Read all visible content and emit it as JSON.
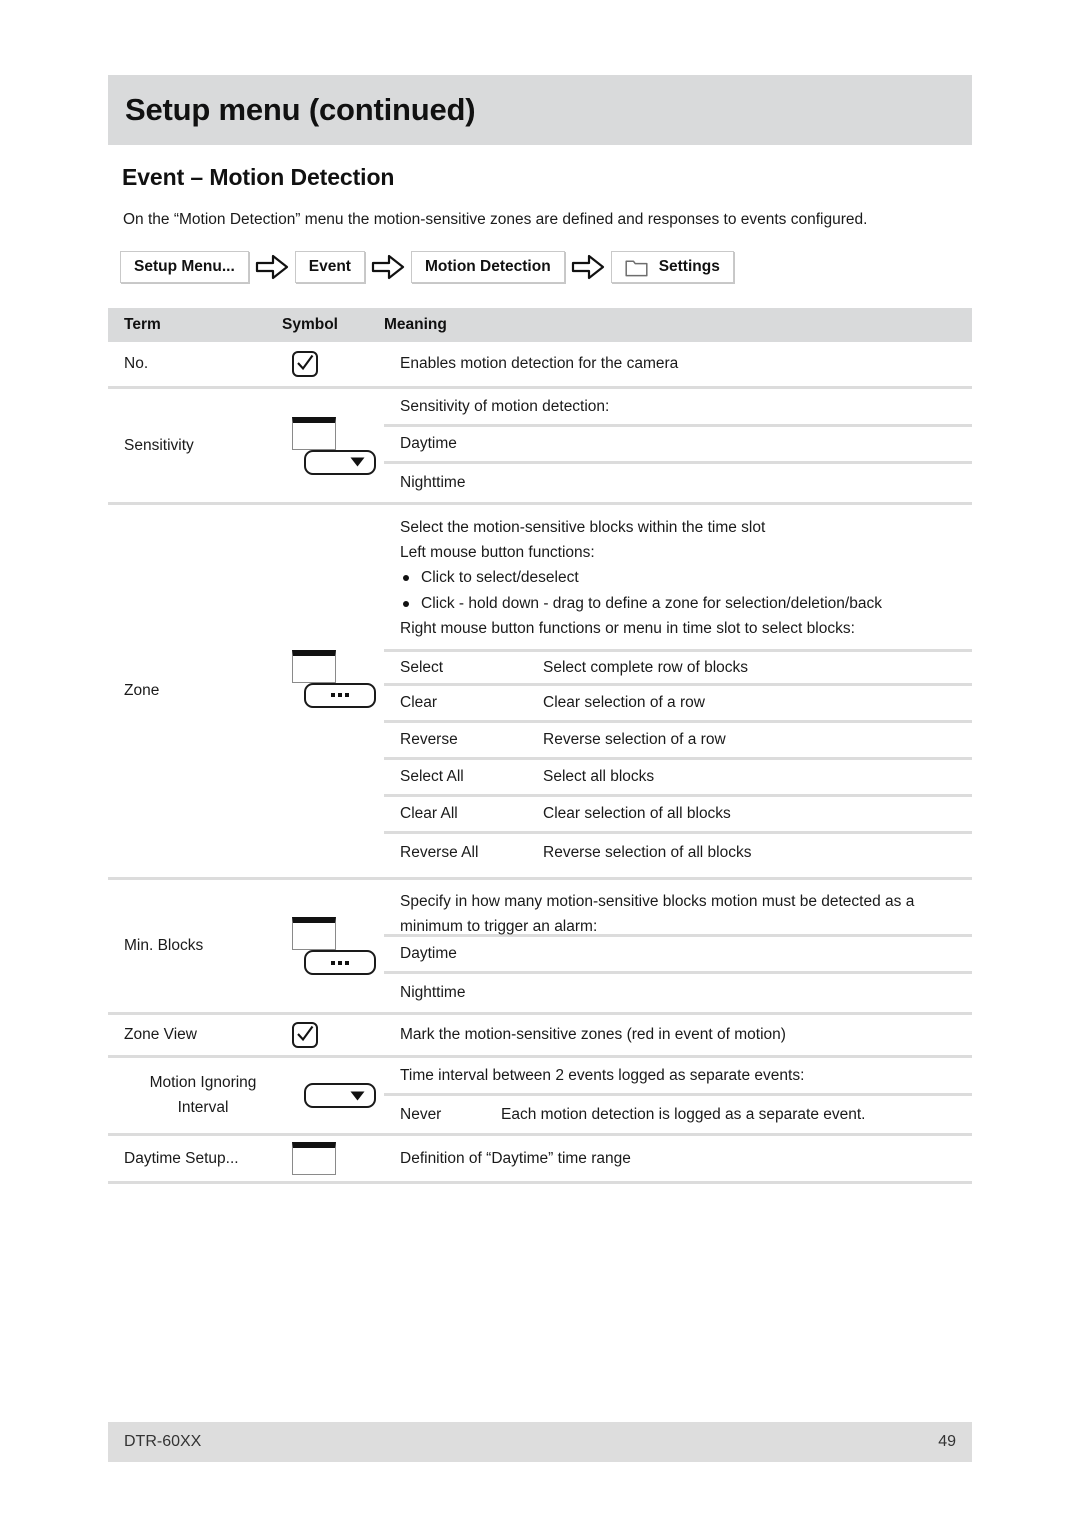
{
  "chapter": {
    "title": "Setup menu (continued)"
  },
  "section": {
    "heading": "Event – Motion Detection",
    "intro": "On the “Motion Detection” menu the motion-sensitive zones are defined and responses to events configured."
  },
  "breadcrumb": {
    "items": [
      {
        "label": "Setup Menu...",
        "icon": null
      },
      {
        "label": "Event",
        "icon": null
      },
      {
        "label": "Motion Detection",
        "icon": null
      },
      {
        "label": "Settings",
        "icon": "folder-icon"
      }
    ],
    "separator_icon": "arrow-right-icon"
  },
  "table": {
    "headers": {
      "term": "Term",
      "symbol": "Symbol",
      "meaning": "Meaning"
    },
    "rows": [
      {
        "term": "No.",
        "symbol": "checkbox-checked-icon",
        "meaning": "Enables motion detection for the camera"
      },
      {
        "term": "Sensitivity",
        "symbol": "textbox-dropdown-icon",
        "lines": [
          "Sensitivity of motion detection:",
          "Daytime",
          "Nighttime"
        ]
      },
      {
        "term": "Zone",
        "symbol": "textbox-ellipsis-button-icon",
        "intro_lines": [
          "Select the motion-sensitive blocks within the time slot",
          "Left mouse button functions:"
        ],
        "bullets": [
          "Click to select/deselect",
          "Click - hold down - drag to define a zone for selection/deletion/back"
        ],
        "after_bullets": "Right mouse button functions or menu in time slot to select blocks:",
        "options": [
          {
            "label": "Select",
            "desc": "Select complete row of blocks"
          },
          {
            "label": "Clear",
            "desc": "Clear selection of a row"
          },
          {
            "label": "Reverse",
            "desc": "Reverse selection of a row"
          },
          {
            "label": "Select All",
            "desc": "Select all blocks"
          },
          {
            "label": "Clear All",
            "desc": "Clear selection of all blocks"
          },
          {
            "label": "Reverse All",
            "desc": "Reverse selection of all blocks"
          }
        ]
      },
      {
        "term": "Min. Blocks",
        "symbol": "textbox-ellipsis-button-icon",
        "intro": "Specify in how many motion-sensitive blocks motion must be detected as a minimum to trigger an alarm:",
        "lines": [
          "Daytime",
          "Nighttime"
        ]
      },
      {
        "term": "Zone View",
        "symbol": "checkbox-checked-icon",
        "meaning": "Mark the motion-sensitive zones (red in event of motion)"
      },
      {
        "term_line1": "Motion Ignoring",
        "term_line2": "Interval",
        "symbol": "dropdown-icon",
        "intro": "Time interval between 2 events logged as separate events:",
        "option": {
          "label": "Never",
          "desc": "Each motion detection is logged as a separate event."
        }
      },
      {
        "term": "Daytime Setup...",
        "symbol": "textbox-icon",
        "meaning": "Definition of “Daytime” time range"
      }
    ]
  },
  "footer": {
    "model": "DTR-60XX",
    "page_number": "49"
  },
  "colors": {
    "band": "#d9dadb",
    "rule": "#dcdcdc",
    "footer": "#dddddd"
  }
}
